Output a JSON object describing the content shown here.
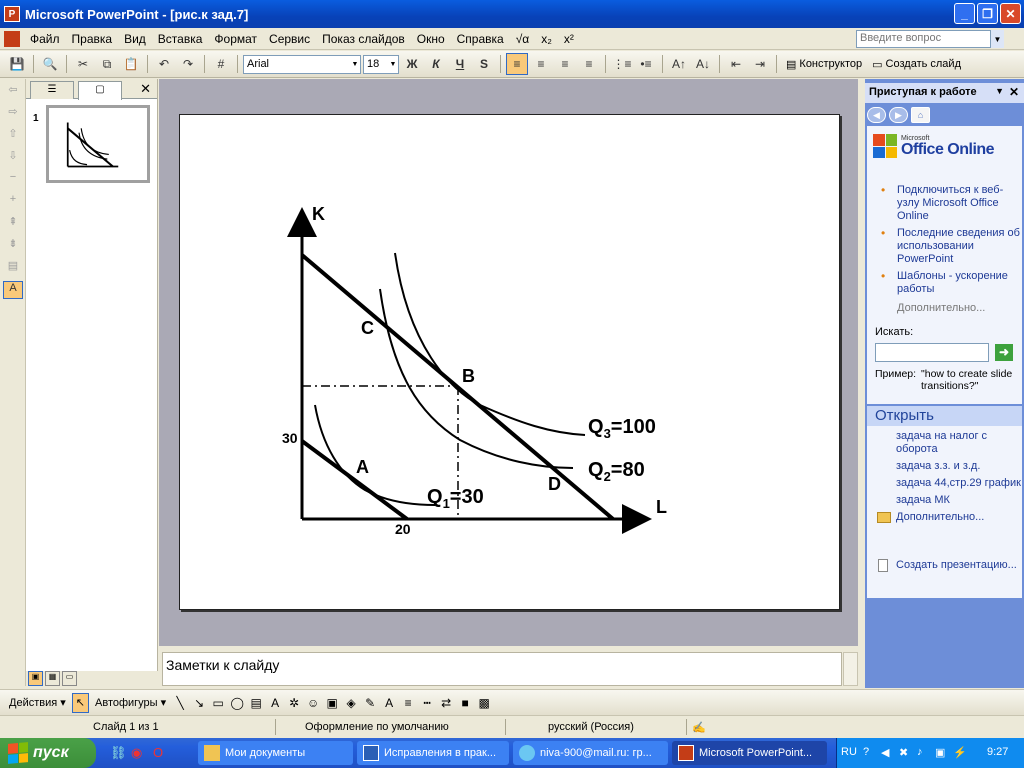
{
  "window": {
    "title": "Microsoft PowerPoint - [рис.к зад.7]",
    "app_icon": "powerpoint-icon",
    "minimize": "_",
    "restore": "❐",
    "close": "✕"
  },
  "menu": {
    "items": [
      "Файл",
      "Правка",
      "Вид",
      "Вставка",
      "Формат",
      "Сервис",
      "Показ слайдов",
      "Окно",
      "Справка"
    ],
    "equation_symbols": [
      "√α",
      "x₂",
      "x²"
    ],
    "help_placeholder": "Введите вопрос"
  },
  "toolbar": {
    "font": "Arial",
    "size": "18",
    "bold": "Ж",
    "italic": "К",
    "underline": "Ч",
    "shadow": "S",
    "designer": "Конструктор",
    "new_slide": "Создать слайд"
  },
  "slides_pane": {
    "slide_number": "1",
    "tab_outline": "☰",
    "tab_slides": "▢",
    "close": "✕"
  },
  "slide": {
    "labels": {
      "k": "K",
      "l": "L",
      "a": "A",
      "b": "B",
      "c": "C",
      "d": "D",
      "tick_k": "30",
      "tick_l": "20",
      "q1": "Q",
      "q1_sub": "1",
      "q1_val": "=30",
      "q2": "Q",
      "q2_sub": "2",
      "q2_val": "=80",
      "q3": "Q",
      "q3_sub": "3",
      "q3_val": "=100"
    }
  },
  "notes": {
    "placeholder": "Заметки к слайду"
  },
  "task_pane": {
    "title": "Приступая к работе",
    "logo_small": "Microsoft",
    "logo_big": "Office Online",
    "links": [
      "Подключиться к веб-узлу Microsoft Office Online",
      "Последние сведения об использовании PowerPoint",
      "Шаблоны - ускорение работы"
    ],
    "more": "Дополнительно...",
    "search_label": "Искать:",
    "example_label": "Пример:",
    "example_text": "\"how to create slide transitions?\"",
    "open_title": "Открыть",
    "recent": [
      "задача на налог с оборота",
      "задача з.з. и з.д.",
      "задача 44,стр.29 график",
      "задача МК"
    ],
    "open_more": "Дополнительно...",
    "create": "Создать презентацию..."
  },
  "drawing": {
    "actions": "Действия",
    "autoshapes": "Автофигуры"
  },
  "status": {
    "slide": "Слайд 1 из 1",
    "design": "Оформление по умолчанию",
    "language": "русский (Россия)"
  },
  "taskbar": {
    "start": "пуск",
    "tasks": [
      "Мои документы",
      "Исправления в прак...",
      "niva-900@mail.ru: гр...",
      "Microsoft PowerPoint..."
    ],
    "lang": "RU",
    "time": "9:27"
  }
}
